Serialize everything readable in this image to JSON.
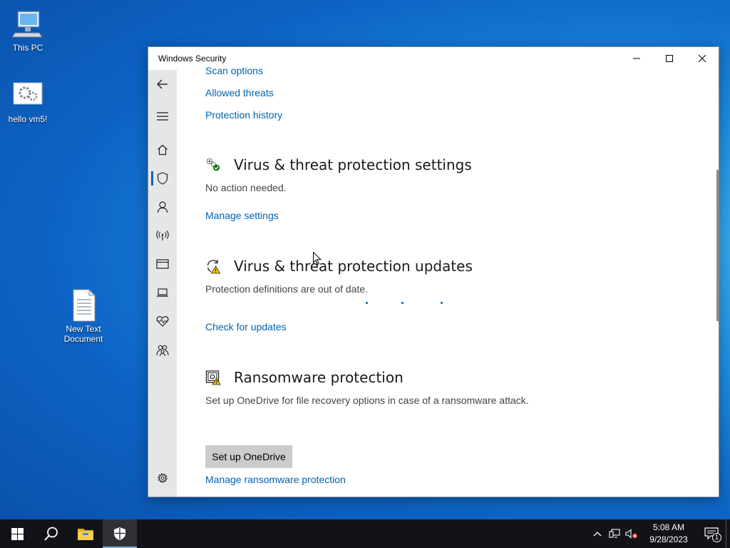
{
  "desktop": {
    "icons": [
      {
        "label": "This PC",
        "icon": "computer-icon"
      },
      {
        "label": "hello vm5!",
        "icon": "gears-shortcut-icon"
      },
      {
        "label": "New Text Document",
        "icon": "text-document-icon"
      }
    ]
  },
  "window": {
    "title": "Windows Security",
    "controls": {
      "minimize": "minimize-icon",
      "maximize": "maximize-icon",
      "close": "close-icon"
    },
    "nav": [
      {
        "icon": "back-arrow-icon"
      },
      {
        "icon": "hamburger-menu-icon"
      },
      {
        "icon": "home-icon"
      },
      {
        "icon": "shield-icon",
        "active": true
      },
      {
        "icon": "person-icon"
      },
      {
        "icon": "wireless-antenna-icon"
      },
      {
        "icon": "app-browser-icon"
      },
      {
        "icon": "laptop-icon"
      },
      {
        "icon": "heart-pulse-icon"
      },
      {
        "icon": "family-icon"
      },
      {
        "icon": "gear-icon"
      }
    ],
    "links_top": {
      "scan_options": "Scan options",
      "allowed_threats": "Allowed threats",
      "protection_history": "Protection history"
    },
    "settings_section": {
      "title": "Virus & threat protection settings",
      "description": "No action needed.",
      "link": "Manage settings"
    },
    "updates_section": {
      "title": "Virus & threat protection updates",
      "description": "Protection definitions are out of date.",
      "link": "Check for updates"
    },
    "ransomware_section": {
      "title": "Ransomware protection",
      "description": "Set up OneDrive for file recovery options in case of a ransomware attack.",
      "button": "Set up OneDrive",
      "link": "Manage ransomware protection"
    }
  },
  "taskbar": {
    "items": [
      "start-icon",
      "search-icon",
      "file-explorer-icon",
      "windows-security-icon"
    ],
    "time": "5:08 AM",
    "date": "9/28/2023",
    "notification_count": "1",
    "colors": {
      "accent": "#0063b1",
      "taskbar": "#111318"
    }
  }
}
